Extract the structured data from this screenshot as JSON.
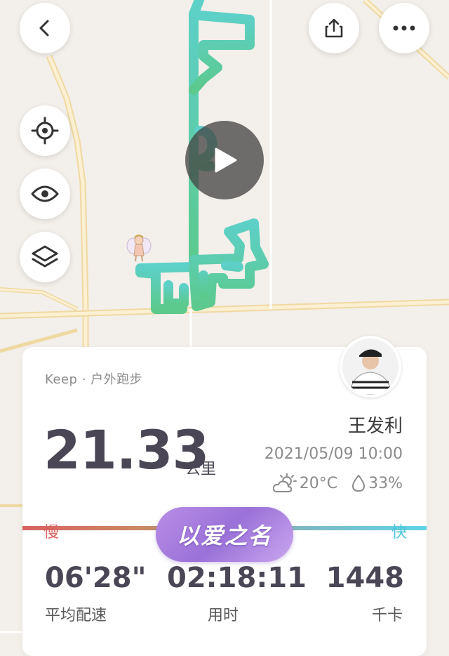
{
  "header": {
    "back_icon": "chevron-left-icon",
    "share_icon": "share-icon",
    "more_icon": "more-icon"
  },
  "map_controls": {
    "locate_icon": "locate-icon",
    "visibility_icon": "eye-icon",
    "layers_icon": "layers-icon",
    "play_icon": "play-icon"
  },
  "route": {
    "start_color": "#5dd0c8",
    "end_color": "#5cc98d"
  },
  "card": {
    "source": "Keep · 户外跑步",
    "distance_value": "21.33",
    "distance_unit": "公里",
    "username": "王发利",
    "datetime": "2021/05/09 10:00",
    "temperature": "20°C",
    "humidity": "33%",
    "pace_slow_label": "慢",
    "pace_fast_label": "快",
    "badge_text": "以爱之名",
    "stats": {
      "pace_value": "06'28\"",
      "pace_label": "平均配速",
      "duration_value": "02:18:11",
      "duration_label": "用时",
      "calories_value": "1448",
      "calories_label": "千卡"
    }
  },
  "colors": {
    "slow": "#d86262",
    "fast": "#4ec6dc",
    "badge": "#9a71d8"
  }
}
